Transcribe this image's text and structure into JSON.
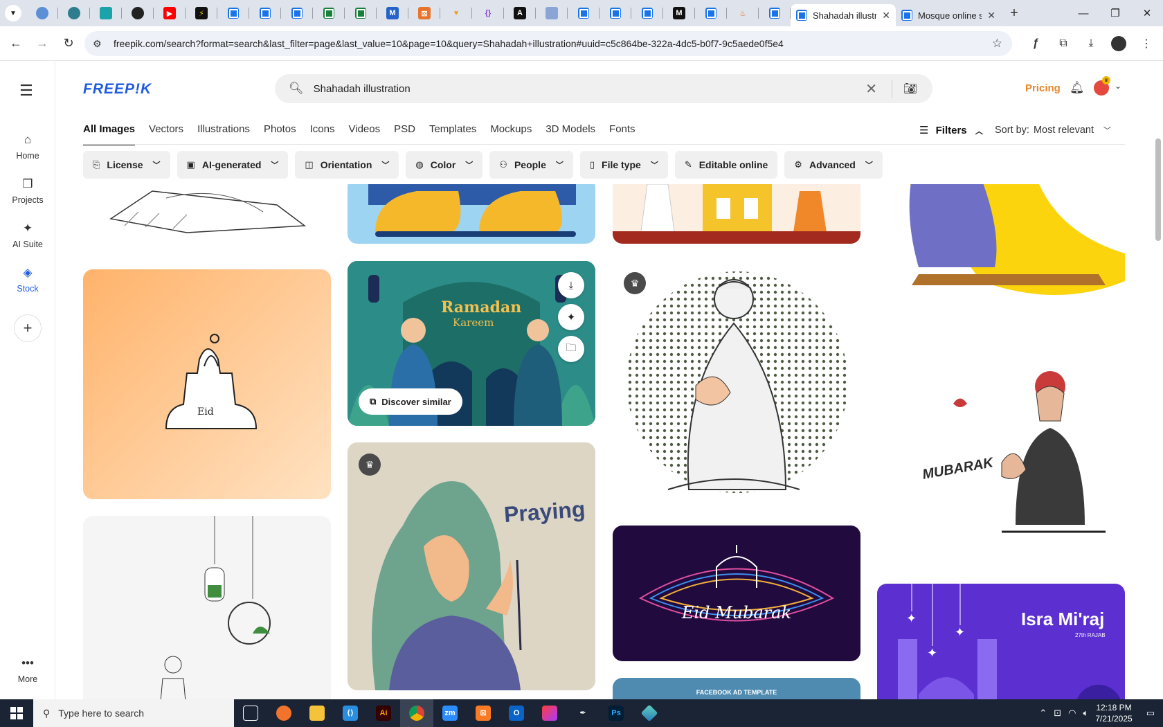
{
  "browser": {
    "tabs": [
      {
        "label": "Shahadah illustra",
        "active": true
      },
      {
        "label": "Mosque online s",
        "active": false
      }
    ],
    "url": "freepik.com/search?format=search&last_filter=page&last_value=10&page=10&query=Shahadah+illustration#uuid=c5c864be-322a-4dc5-b0f7-9c5aede0f5e4"
  },
  "rail": {
    "items": [
      {
        "label": "Home"
      },
      {
        "label": "Projects"
      },
      {
        "label": "AI Suite"
      },
      {
        "label": "Stock"
      },
      {
        "label": "More"
      }
    ]
  },
  "header": {
    "logo": "FREEP!K",
    "search_value": "Shahadah illustration",
    "pricing": "Pricing"
  },
  "categories": [
    "All Images",
    "Vectors",
    "Illustrations",
    "Photos",
    "Icons",
    "Videos",
    "PSD",
    "Templates",
    "Mockups",
    "3D Models",
    "Fonts"
  ],
  "controls": {
    "filters": "Filters",
    "sort_label": "Sort by:",
    "sort_value": "Most relevant"
  },
  "chips": [
    "License",
    "AI-generated",
    "Orientation",
    "Color",
    "People",
    "File type",
    "Editable online",
    "Advanced"
  ],
  "cards": {
    "ramadan_title": "Ramadan",
    "ramadan_sub": "Kareem",
    "discover": "Discover similar",
    "praying": "Praying",
    "eid_text": "Eid Mubarak",
    "eid_mubarak_red": "MUBARAK",
    "isra_title": "Isra Mi'raj",
    "isra_sub": "27th RAJAB",
    "fb_template": "FACEBOOK AD TEMPLATE"
  },
  "taskbar": {
    "search_placeholder": "Type here to search",
    "time": "12:18 PM",
    "date": "7/21/2025"
  },
  "colors": {
    "brand": "#1f5ce0",
    "pricing": "#e8872c",
    "taskbar": "#1b2434"
  }
}
